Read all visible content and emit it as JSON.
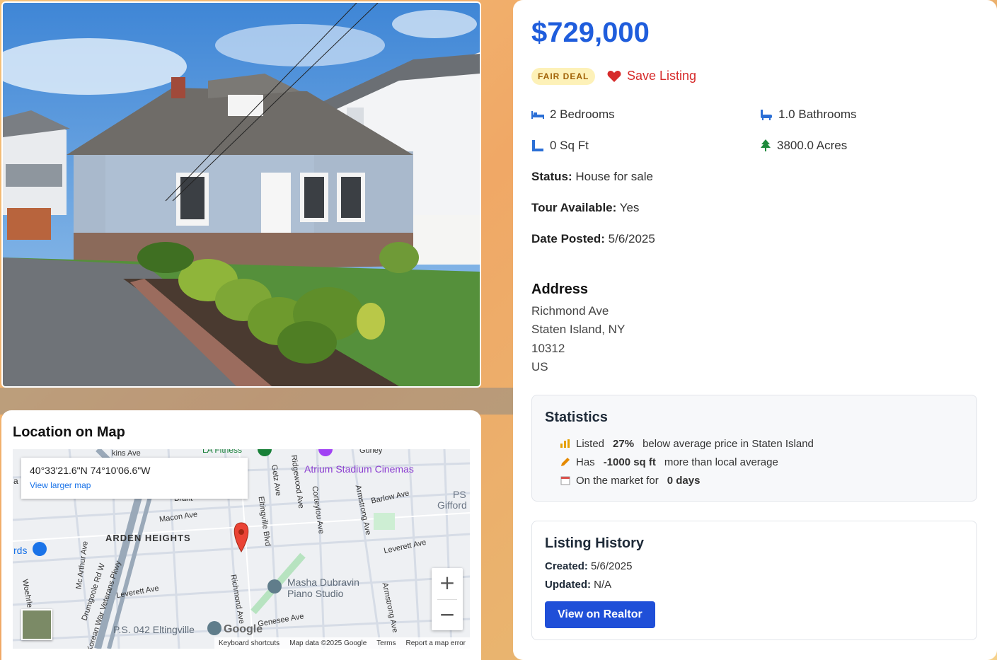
{
  "listing": {
    "price": "$729,000",
    "deal_badge": "FAIR DEAL",
    "save_label": "Save Listing",
    "features": {
      "bedrooms": "2 Bedrooms",
      "bathrooms": "1.0 Bathrooms",
      "sqft": "0 Sq Ft",
      "acres": "3800.0 Acres"
    },
    "status_label": "Status:",
    "status_value": "House for sale",
    "tour_label": "Tour Available:",
    "tour_value": "Yes",
    "date_label": "Date Posted:",
    "date_value": "5/6/2025"
  },
  "address": {
    "title": "Address",
    "street": "Richmond Ave",
    "city_state": "Staten Island, NY",
    "zip": "10312",
    "country": "US"
  },
  "statistics": {
    "title": "Statistics",
    "rows": [
      {
        "icon": "bar-chart-icon",
        "prefix": "Listed",
        "value": "27%",
        "suffix": "below average price in Staten Island"
      },
      {
        "icon": "pencil-icon",
        "prefix": "Has",
        "value": "-1000 sq ft",
        "suffix": "more than local average"
      },
      {
        "icon": "calendar-icon",
        "prefix": "On the market for",
        "value": "0 days",
        "suffix": ""
      }
    ]
  },
  "history": {
    "title": "Listing History",
    "created_label": "Created:",
    "created_value": "5/6/2025",
    "updated_label": "Updated:",
    "updated_value": "N/A",
    "button_label": "View on Realtor"
  },
  "map": {
    "title": "Location on Map",
    "coords": "40°33'21.6\"N 74°10'06.6\"W",
    "view_larger": "View larger map",
    "zoom_in": "+",
    "zoom_out": "−",
    "google": "Google",
    "footer": {
      "shortcuts": "Keyboard shortcuts",
      "map_data": "Map data ©2025 Google",
      "terms": "Terms",
      "report": "Report a map error"
    },
    "labels": {
      "arden_heights": "ARDEN HEIGHTS",
      "atrium": "Atrium Stadium Cinemas",
      "masha": "Masha Dubravin",
      "piano": "Piano Studio",
      "ps042": "P.S. 042 Eltingville",
      "macon": "Macon Ave",
      "barlow": "Barlow Ave",
      "leverett1": "Leverett Ave",
      "leverett2": "Leverett Ave",
      "genesee": "Genesee Ave",
      "richmond": "Richmond Ave",
      "eltingville": "Eltingville Blvd",
      "getz": "Getz Ave",
      "ridgewood": "Ridgewood Ave",
      "corteylou": "Corteylou Ave",
      "armstrong1": "Armstrong Ave",
      "armstrong2": "Armstrong Ave",
      "drumgoole": "Drumgoole Rd W",
      "veterans": "Korean War Veterans Pkwy",
      "mcarthur": "Mc Arthur Ave",
      "woehrle": "Woehrle",
      "la_fitness": "LA Fitness",
      "ps_gifford_1": "PS",
      "ps_gifford_2": "Gifford",
      "rds": "rds",
      "brant": "Brant",
      "aps_ave": "kins Ave",
      "gurley": "Gurley",
      "edge_a": "a"
    }
  },
  "colors": {
    "price": "#1f5ddc",
    "badge_bg": "#fdf1b8",
    "badge_text": "#a16207",
    "save": "#d62b2b",
    "button": "#1f4fd8",
    "pin": "#ea4335"
  }
}
